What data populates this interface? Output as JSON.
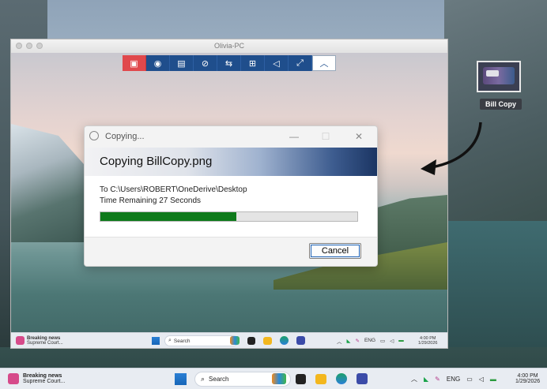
{
  "remote_window": {
    "title": "Olivia-PC",
    "toolbar": [
      {
        "icon": "stop-control-icon",
        "glyph": "▣"
      },
      {
        "icon": "view-icon",
        "glyph": "◉"
      },
      {
        "icon": "tools-icon",
        "glyph": "▤"
      },
      {
        "icon": "actions-icon",
        "glyph": "⊘"
      },
      {
        "icon": "transfer-icon",
        "glyph": "⇆"
      },
      {
        "icon": "apps-icon",
        "glyph": "⊞"
      },
      {
        "icon": "sound-icon",
        "glyph": "◁"
      },
      {
        "icon": "fullscreen-icon",
        "glyph": "⤢"
      },
      {
        "icon": "collapse-icon",
        "glyph": "︿"
      }
    ]
  },
  "dialog": {
    "title": "Copying...",
    "minimize_glyph": "—",
    "maximize_glyph": "☐",
    "close_glyph": "✕",
    "heading": "Copying  BillCopy.png",
    "destination": "To  C:\\Users\\ROBERT\\OneDerive\\Desktop",
    "time_remaining": "Time Remaining 27 Seconds",
    "progress_fraction": 0.53,
    "cancel_label": "Cancel"
  },
  "inner_taskbar": {
    "news_title": "Breaking news",
    "news_sub": "Supreme Court...",
    "search_label": "Search",
    "lang": "ENG",
    "time": "4:00 PM",
    "date": "1/29/2026"
  },
  "desktop_icon": {
    "label": "Bill Copy"
  },
  "outer_taskbar": {
    "news_title": "Breaking news",
    "news_sub": "Supreme Court...",
    "search_label": "Search",
    "lang": "ENG",
    "time": "4:00 PM",
    "date": "1/29/2026"
  },
  "colors": {
    "progress": "#0e7a1b",
    "toolbar_blue": "#1f4e8c",
    "toolbar_red": "#e0484c"
  }
}
